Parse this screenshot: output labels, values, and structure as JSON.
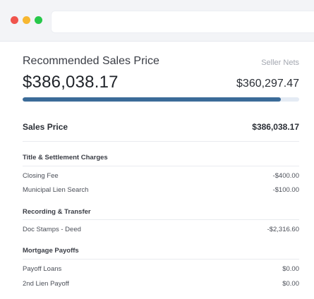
{
  "summary": {
    "title": "Recommended Sales Price",
    "price": "$386,038.17",
    "seller_nets_label": "Seller Nets",
    "seller_nets_value": "$360,297.47",
    "net_fraction": 0.9333
  },
  "sales_price": {
    "label": "Sales Price",
    "value": "$386,038.17"
  },
  "sections": [
    {
      "heading": "Title & Settlement Charges",
      "items": [
        {
          "label": "Closing Fee",
          "value": "-$400.00"
        },
        {
          "label": "Municipal Lien Search",
          "value": "-$100.00"
        }
      ]
    },
    {
      "heading": "Recording & Transfer",
      "items": [
        {
          "label": "Doc Stamps - Deed",
          "value": "-$2,316.60"
        }
      ]
    },
    {
      "heading": "Mortgage Payoffs",
      "items": [
        {
          "label": "Payoff Loans",
          "value": "$0.00"
        },
        {
          "label": "2nd Lien Payoff",
          "value": "$0.00"
        }
      ]
    }
  ]
}
